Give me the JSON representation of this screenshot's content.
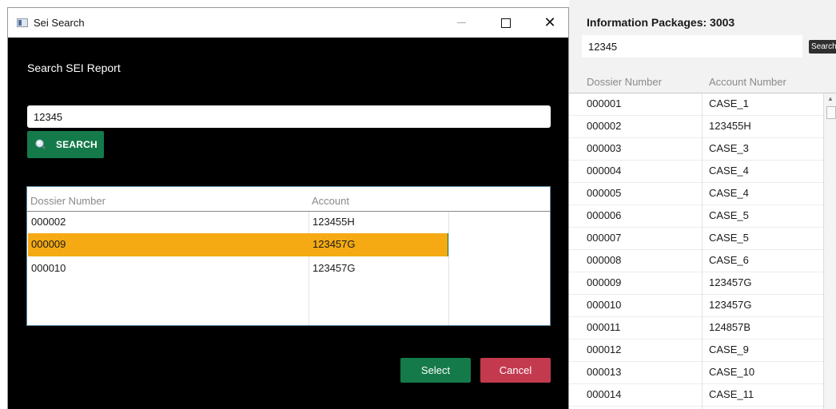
{
  "background_panel": {
    "title": "Information Packages: 3003",
    "search_value": "12345",
    "search_button_label": "Search",
    "columns": [
      "Dossier Number",
      "Account Number"
    ],
    "rows": [
      [
        "000001",
        "CASE_1"
      ],
      [
        "000002",
        "123455H"
      ],
      [
        "000003",
        "CASE_3"
      ],
      [
        "000004",
        "CASE_4"
      ],
      [
        "000005",
        "CASE_4"
      ],
      [
        "000006",
        "CASE_5"
      ],
      [
        "000007",
        "CASE_5"
      ],
      [
        "000008",
        "CASE_6"
      ],
      [
        "000009",
        "123457G"
      ],
      [
        "000010",
        "123457G"
      ],
      [
        "000011",
        "124857B"
      ],
      [
        "000012",
        "CASE_9"
      ],
      [
        "000013",
        "CASE_10"
      ],
      [
        "000014",
        "CASE_11"
      ]
    ]
  },
  "dialog": {
    "window_title": "Sei Search",
    "heading": "Search SEI Report",
    "search_value": "12345",
    "search_button_label": "SEARCH",
    "columns": [
      "Dossier Number",
      "Account"
    ],
    "rows": [
      [
        "000002",
        "123455H"
      ],
      [
        "000009",
        "123457G"
      ],
      [
        "000010",
        "123457G"
      ]
    ],
    "selected_row_index": 1,
    "select_label": "Select",
    "cancel_label": "Cancel"
  },
  "colors": {
    "dialog_background": "#000000",
    "primary_button": "#157a4a",
    "cancel_button": "#c33a4f",
    "selection": "#f5aa14"
  },
  "icons": {
    "window": "app-window-icon",
    "search": "magnifier-icon",
    "minimize": "minimize-icon",
    "maximize": "maximize-icon",
    "close": "close-icon"
  }
}
